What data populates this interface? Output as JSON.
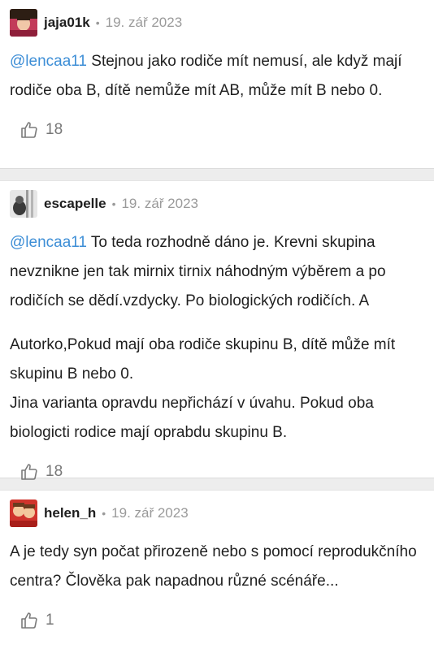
{
  "comments": [
    {
      "username": "jaja01k",
      "date": "19. zář 2023",
      "mention": "@lencaa11",
      "paragraphs": [
        " Stejnou jako rodiče mít nemusí, ale když mají rodiče oba B, dítě nemůže mít AB, může mít B nebo 0."
      ],
      "likes": "18",
      "avatar_colors": [
        "#c23b5a",
        "#2d1e14",
        "#f1c7a8"
      ]
    },
    {
      "username": "escapelle",
      "date": "19. zář 2023",
      "mention": "@lencaa11",
      "paragraphs": [
        " To teda rozhodně dáno je. Krevni skupina nevznikne jen tak mirnix tirnix náhodným výběrem a po rodičích se dědí.vzdycky. Po biologických rodičích. A",
        "Autorko,Pokud mají oba rodiče skupinu B, dítě může mít skupinu B nebo 0.",
        "Jina varianta opravdu nepřichází v úvahu. Pokud oba biologicti rodice mají oprabdu skupinu B."
      ],
      "likes": "18",
      "avatar_colors": [
        "#9a9a9a",
        "#3a3a3a",
        "#e6e6e6"
      ]
    },
    {
      "username": "helen_h",
      "date": "19. zář 2023",
      "mention": "",
      "paragraphs": [
        "A je tedy syn počat přirozeně nebo s pomocí reprodukčního centra? Člověka pak napadnou různé scénáře..."
      ],
      "likes": "1",
      "avatar_colors": [
        "#d0342c",
        "#f3c89c",
        "#6b3a1e"
      ]
    }
  ],
  "icons": {
    "like": "thumbs-up-icon",
    "separator_dot": "•"
  },
  "colors": {
    "mention": "#3d8ed6",
    "meta": "#9a9a9a",
    "separator": "#ededed"
  }
}
